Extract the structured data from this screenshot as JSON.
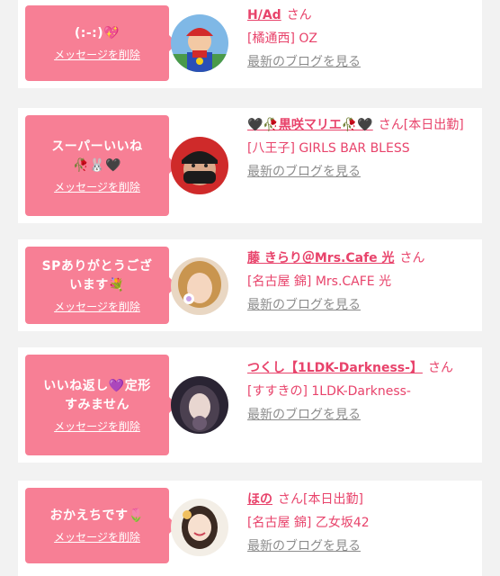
{
  "items": [
    {
      "message": "(:-:)💖",
      "delete_label": "メッセージを削除",
      "name": "H/Ad",
      "honorific": "さん",
      "shop": "[橘通西] OZ",
      "blog_label": "最新のブログを見る"
    },
    {
      "message": "スーパーいいね\n🥀🐰🖤",
      "delete_label": "メッセージを削除",
      "name": "🖤🥀黒咲マリエ🥀🖤",
      "honorific": "さん[本日出勤]",
      "shop": "[八王子] GIRLS BAR BLESS",
      "blog_label": "最新のブログを見る"
    },
    {
      "message": "SPありがとうござ\nいます💐",
      "delete_label": "メッセージを削除",
      "name": "藤 きらり＠Mrs.Cafe 光",
      "honorific": "さん",
      "shop": "[名古屋 錦] Mrs.CAFE 光",
      "blog_label": "最新のブログを見る"
    },
    {
      "message": "いいね返し💜定形\nすみません",
      "delete_label": "メッセージを削除",
      "name": "つくし【1LDK-Darkness-】",
      "honorific": "さん",
      "shop": "[すすきの] 1LDK-Darkness-",
      "blog_label": "最新のブログを見る"
    },
    {
      "message": "おかえちです🌷",
      "delete_label": "メッセージを削除",
      "name": "ほの",
      "honorific": "さん[本日出勤]",
      "shop": "[名古屋 錦] 乙女坂42",
      "blog_label": "最新のブログを見る"
    }
  ],
  "colors": {
    "bubble": "#f77f95",
    "accent": "#e8436b",
    "muted": "#8c8c8c",
    "card": "#ffffff",
    "background": "#f2f2f2"
  },
  "icons": [
    "avatar-mario",
    "avatar-masked-man",
    "avatar-blonde-woman",
    "avatar-dark-haired-woman",
    "avatar-smiling-woman"
  ]
}
